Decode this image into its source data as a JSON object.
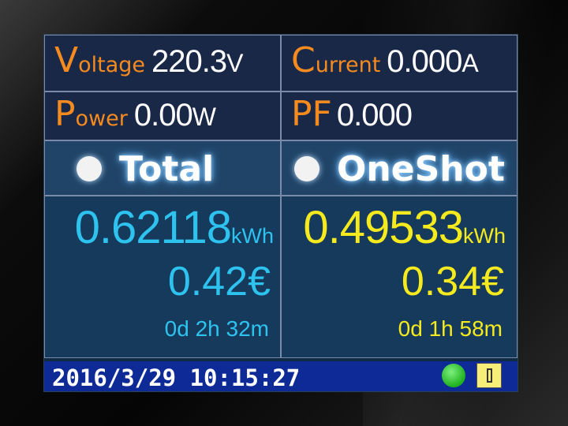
{
  "readings": {
    "voltage": {
      "label_initial": "V",
      "label_rest": "oltage",
      "value": "220.3",
      "unit": "V"
    },
    "current": {
      "label_initial": "C",
      "label_rest": "urrent",
      "value": "0.000",
      "unit": "A"
    },
    "power": {
      "label_initial": "P",
      "label_rest": "ower",
      "value": "0.00",
      "unit": "W"
    },
    "pf": {
      "label": "PF",
      "value": "0.000"
    }
  },
  "tabs": [
    {
      "label": "Total"
    },
    {
      "label": "OneShot"
    }
  ],
  "total": {
    "energy_value": "0.62118",
    "energy_unit": "kWh",
    "cost": "0.42€",
    "duration": "0d 2h 32m"
  },
  "oneshot": {
    "energy_value": "0.49533",
    "energy_unit": "kWh",
    "cost": "0.34€",
    "duration": "0d 1h 58m"
  },
  "status_bar": {
    "datetime": "2016/3/29 10:15:27",
    "status_indicator": "green-status-icon",
    "storage_icon": "sd-card-icon"
  },
  "colors": {
    "label_orange": "#f58a1f",
    "total_cyan": "#2ec3ef",
    "oneshot_yellow": "#f5ea1e",
    "status_bar": "#0e2a96"
  }
}
